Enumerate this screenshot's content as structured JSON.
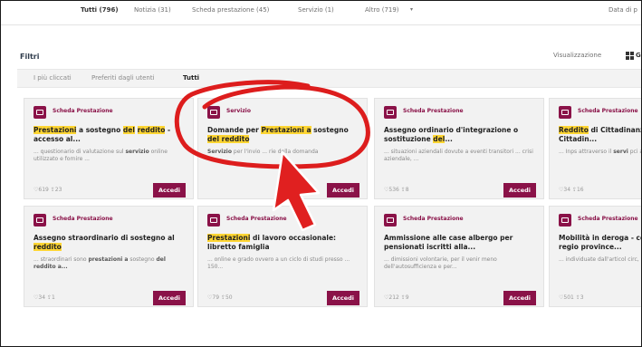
{
  "topbar": {
    "tabs": [
      {
        "label": "Tutti (796)",
        "active": true
      },
      {
        "label": "Notizia (31)",
        "active": false
      },
      {
        "label": "Scheda prestazione (45)",
        "active": false
      },
      {
        "label": "Servizio (1)",
        "active": false
      },
      {
        "label": "Altro (719)",
        "active": false
      }
    ],
    "data_label": "Data di p"
  },
  "filtri_label": "Filtri",
  "visualizzazione_label": "Visualizzazione",
  "grid_label_tail": "G",
  "subtabs": [
    {
      "label": "I più cliccati",
      "active": false
    },
    {
      "label": "Preferiti dagli utenti",
      "active": false
    },
    {
      "label": "Tutti",
      "active": true
    }
  ],
  "accedi_label": "Accedi",
  "cards": [
    {
      "type": "Scheda Prestazione",
      "title": [
        {
          "t": "Prestazioni",
          "h": true
        },
        {
          "t": " a sostegno "
        },
        {
          "t": "del",
          "h": true
        },
        {
          "t": " "
        },
        {
          "t": "reddito",
          "h": true
        },
        {
          "t": " - accesso al..."
        }
      ],
      "desc": [
        {
          "t": "... questionario di valutazione sul "
        },
        {
          "t": "servizio",
          "b": true
        },
        {
          "t": " online utilizzato e fornire ..."
        }
      ],
      "views": "619",
      "likes": "23"
    },
    {
      "type": "Servizio",
      "title": [
        {
          "t": "Domande per "
        },
        {
          "t": "Prestazioni",
          "h": true
        },
        {
          "t": " a",
          "h": true
        },
        {
          "t": " sostegno "
        },
        {
          "t": "del reddito",
          "h": true
        }
      ],
      "desc": [
        {
          "t": "Servizio",
          "b": true
        },
        {
          "t": " per l'invio ... rie della domanda"
        }
      ],
      "views": "",
      "likes": ""
    },
    {
      "type": "Scheda Prestazione",
      "title": [
        {
          "t": "Assegno ordinario d'integrazione o sostituzione "
        },
        {
          "t": "del",
          "h": true
        },
        {
          "t": "..."
        }
      ],
      "desc": [
        {
          "t": "... situazioni aziendali dovute a eventi transitori ... crisi aziendale, ..."
        }
      ],
      "views": "536",
      "likes": "8"
    },
    {
      "type": "Scheda Prestazione",
      "title": [
        {
          "t": "Reddito",
          "h": true
        },
        {
          "t": " di Cittadinanza Pensione di Cittadin..."
        }
      ],
      "desc": [
        {
          "t": "... Inps attraverso il "
        },
        {
          "t": "servi",
          "b": true
        },
        {
          "t": " pci al..."
        }
      ],
      "views": "34",
      "likes": "16"
    },
    {
      "type": "Scheda Prestazione",
      "title": [
        {
          "t": "Assegno straordinario di sostegno al "
        },
        {
          "t": "reddito",
          "h": true
        }
      ],
      "desc": [
        {
          "t": "... straordinari sono "
        },
        {
          "t": "prestazioni a",
          "b": true
        },
        {
          "t": " sostegno "
        },
        {
          "t": "del reddito a...",
          "b": true
        }
      ],
      "views": "34",
      "likes": "1"
    },
    {
      "type": "Scheda Prestazione",
      "title": [
        {
          "t": "Prestazioni",
          "h": true
        },
        {
          "t": " di lavoro occasionale: libretto famiglia"
        }
      ],
      "desc": [
        {
          "t": "... online e grado ovvero a un ciclo di studi presso ... 150..."
        }
      ],
      "views": "79",
      "likes": "50"
    },
    {
      "type": "Scheda Prestazione",
      "title": [
        {
          "t": "Ammissione alle case albergo per pensionati iscritti alla..."
        }
      ],
      "desc": [
        {
          "t": "... dimissioni volontarie, per il venir meno dell'autosufficienza e per..."
        }
      ],
      "views": "212",
      "likes": "9"
    },
    {
      "type": "Scheda Prestazione",
      "title": [
        {
          "t": "Mobilità in deroga - concessa dalle regio province..."
        }
      ],
      "desc": [
        {
          "t": "... individuate dall'articol circ, per i quali ... essere"
        }
      ],
      "views": "501",
      "likes": "3"
    }
  ],
  "annotation_colors": {
    "circle": "#dd1d1d",
    "arrow": "#e02020"
  }
}
